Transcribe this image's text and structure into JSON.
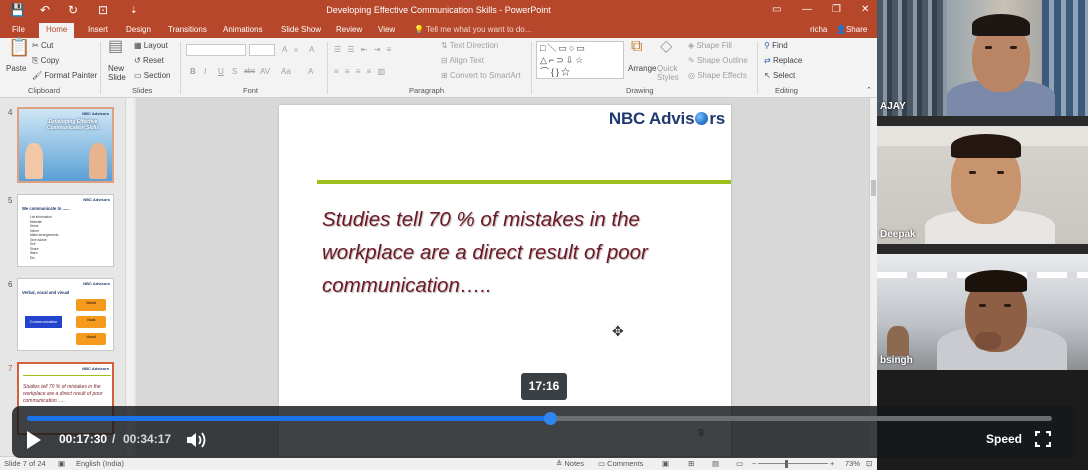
{
  "ppt": {
    "title": "Developing Effective Communication Skills - PowerPoint",
    "window_controls": {
      "minimize": "—",
      "restore": "❐",
      "close": "✕"
    },
    "quick_access": {
      "save": "💾",
      "undo": "↶",
      "redo": "↻",
      "present": "⊡"
    },
    "tabs": [
      "File",
      "Home",
      "Insert",
      "Design",
      "Transitions",
      "Animations",
      "Slide Show",
      "Review",
      "View"
    ],
    "active_tab": "Home",
    "tell_me": "Tell me what you want to do...",
    "user": "richa",
    "share": "Share",
    "ribbon": {
      "clipboard": {
        "paste": "Paste",
        "cut": "Cut",
        "copy": "Copy",
        "format_painter": "Format Painter",
        "label": "Clipboard"
      },
      "slides": {
        "new_slide": "New Slide",
        "layout": "Layout",
        "reset": "Reset",
        "section": "Section",
        "label": "Slides"
      },
      "font": {
        "bold": "B",
        "italic": "I",
        "underline": "U",
        "strike": "S",
        "shadow": "abc",
        "spacing": "AV",
        "case": "Aa",
        "grow": "A",
        "shrink": "A",
        "clear": "A",
        "color": "A",
        "label": "Font"
      },
      "paragraph": {
        "text_direction": "Text Direction",
        "align_text": "Align Text",
        "convert_smartart": "Convert to SmartArt",
        "label": "Paragraph"
      },
      "drawing": {
        "shapes": "□ \\ ▭ ○ ▭\n△ ⌐ ⊃ ⇩ ☆\n⌒ { } ☆",
        "arrange": "Arrange",
        "quick_styles": "Quick Styles",
        "shape_fill": "Shape Fill",
        "shape_outline": "Shape Outline",
        "shape_effects": "Shape Effects",
        "label": "Drawing"
      },
      "editing": {
        "find": "Find",
        "replace": "Replace",
        "select": "Select",
        "label": "Editing"
      }
    },
    "thumbnails": [
      {
        "num": "4",
        "logo": "NBC Advisors",
        "title": "Developing Effective Communication Skills"
      },
      {
        "num": "5",
        "logo": "NBC Advisors",
        "title": "We communicate to ......",
        "bullets": [
          "List information",
          "Motivate",
          "Direct",
          "Inform",
          "Make arrangements",
          "Give advice",
          "Sell",
          "Share",
          "Warn",
          "Etc."
        ]
      },
      {
        "num": "6",
        "logo": "NBC Advisors",
        "title": "Verbal, vocal and visual",
        "center": "Communication",
        "boxes": [
          "Verbal",
          "Vocal",
          "Visual"
        ]
      },
      {
        "num": "7",
        "logo": "NBC Advisors",
        "quote": "Studies tell 70 % of mistakes in the workplace are a direct result of poor communication ....."
      }
    ],
    "slide": {
      "logo_left": "NBC Advis",
      "logo_right": "rs",
      "quote_line1": "Studies tell 70 % of mistakes in the",
      "quote_line2": "workplace are a direct result of poor",
      "quote_line3": "communication…..",
      "page_number": "9"
    },
    "status": {
      "slide_of": "Slide 7 of 24",
      "language": "English (India)",
      "notes": "Notes",
      "comments": "Comments",
      "zoom": "73%"
    }
  },
  "participants": [
    {
      "name": "AJAY"
    },
    {
      "name": "Deepak"
    },
    {
      "name": "bsingh"
    }
  ],
  "player": {
    "tooltip_time": "17:16",
    "current_time": "00:17:30",
    "separator": "/",
    "total_time": "00:34:17",
    "progress": 0.51,
    "speed_label": "Speed"
  },
  "colors": {
    "ppt_accent": "#b7472a",
    "progress": "#1a73e8",
    "slide_quote": "#6e1725",
    "slide_rule": "#9cc01e",
    "logo": "#1f3a6e"
  }
}
